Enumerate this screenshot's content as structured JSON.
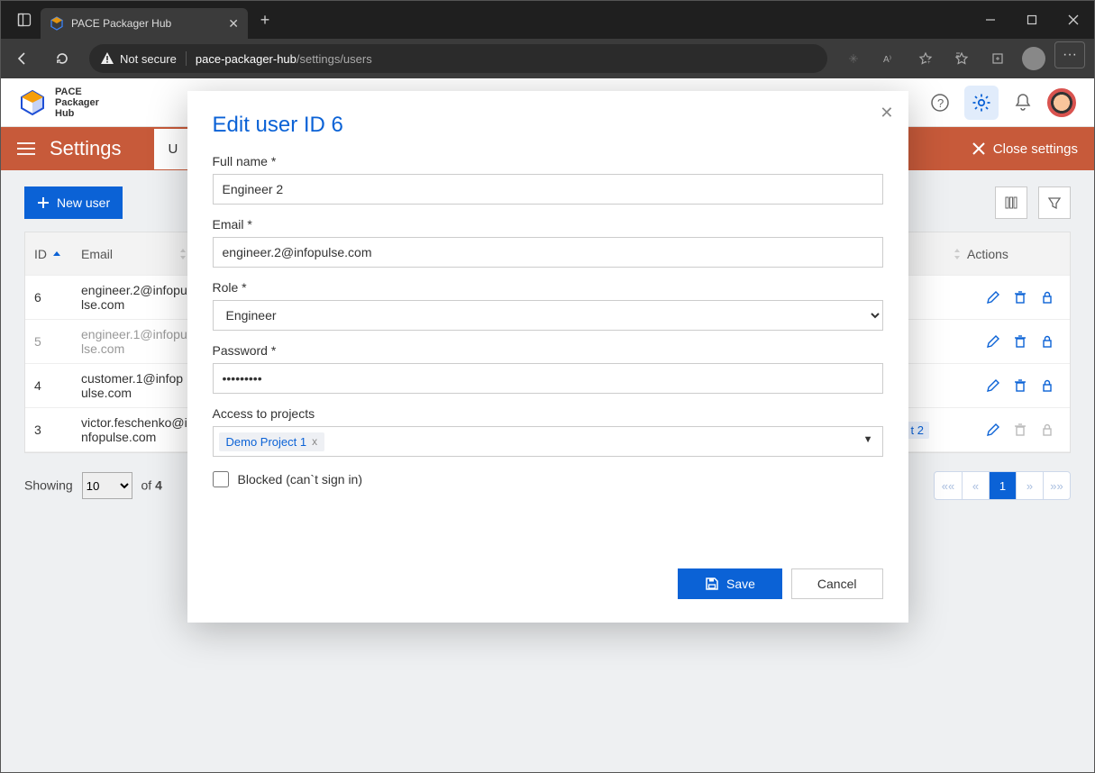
{
  "browser": {
    "tab_title": "PACE Packager Hub",
    "not_secure": "Not secure",
    "url_host": "pace-packager-hub",
    "url_path": "/settings/users"
  },
  "brand": {
    "line1": "PACE",
    "line2": "Packager",
    "line3": "Hub"
  },
  "settings_strip": {
    "title": "Settings",
    "tab_letter": "U",
    "close": "Close settings"
  },
  "toolbar": {
    "new_user": "New user"
  },
  "table": {
    "headers": {
      "id": "ID",
      "email": "Email",
      "actions": "Actions"
    },
    "rows": [
      {
        "id": "6",
        "email": "engineer.2@infopulse.com",
        "muted": false,
        "trail_badge": null
      },
      {
        "id": "5",
        "email": "engineer.1@infopulse.com",
        "muted": true,
        "trail_badge": null
      },
      {
        "id": "4",
        "email": "customer.1@infopulse.com",
        "muted": false,
        "trail_badge": null
      },
      {
        "id": "3",
        "email": "victor.feschenko@infopulse.com",
        "muted": false,
        "trail_badge": "t 2"
      }
    ]
  },
  "pager": {
    "showing": "Showing",
    "page_size": "10",
    "of": "of",
    "total": "4",
    "first": "««",
    "prev": "«",
    "current": "1",
    "next": "»",
    "last": "»»"
  },
  "modal": {
    "title": "Edit user ID 6",
    "labels": {
      "full_name": "Full name *",
      "email": "Email *",
      "role": "Role *",
      "password": "Password *",
      "access": "Access to projects",
      "blocked": "Blocked (can`t sign in)"
    },
    "values": {
      "full_name": "Engineer 2",
      "email": "engineer.2@infopulse.com",
      "role": "Engineer",
      "password": "*********",
      "project_tag": "Demo Project 1"
    },
    "buttons": {
      "save": "Save",
      "cancel": "Cancel"
    }
  }
}
